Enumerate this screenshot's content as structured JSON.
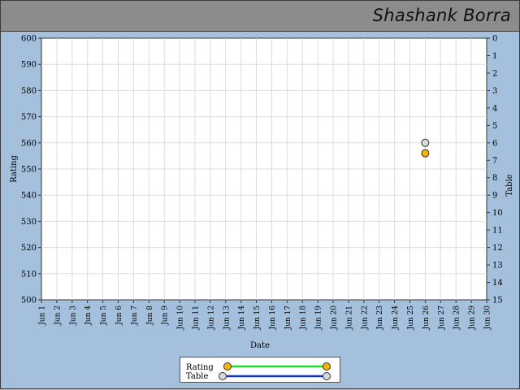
{
  "header": {
    "title": "Shashank Borra"
  },
  "colors": {
    "background": "#a5c0dc",
    "header_bg": "#8c8c8c",
    "plot_bg": "#ffffff",
    "grid": "#dddddd",
    "rating_marker": "#f5b400",
    "rating_line": "#22dd22",
    "table_marker": "#d8d8e0",
    "table_line": "#1133bb"
  },
  "chart_data": {
    "type": "scatter",
    "xlabel": "Date",
    "ylabel": "Rating",
    "y2label": "Table",
    "categories": [
      "Jun 1",
      "Jun 2",
      "Jun 3",
      "Jun 4",
      "Jun 5",
      "Jun 6",
      "Jun 7",
      "Jun 8",
      "Jun 9",
      "Jun 10",
      "Jun 11",
      "Jun 12",
      "Jun 13",
      "Jun 14",
      "Jun 15",
      "Jun 16",
      "Jun 17",
      "Jun 18",
      "Jun 19",
      "Jun 20",
      "Jun 21",
      "Jun 22",
      "Jun 23",
      "Jun 24",
      "Jun 25",
      "Jun 26",
      "Jun 27",
      "Jun 28",
      "Jun 29",
      "Jun 30"
    ],
    "ylim": [
      500,
      600
    ],
    "yticks": [
      "500",
      "510",
      "520",
      "530",
      "540",
      "550",
      "560",
      "570",
      "580",
      "590",
      "600"
    ],
    "y2lim": [
      0,
      15
    ],
    "y2ticks": [
      "0",
      "1",
      "2",
      "3",
      "4",
      "5",
      "6",
      "7",
      "8",
      "9",
      "10",
      "11",
      "12",
      "13",
      "14",
      "15"
    ],
    "grid": true,
    "legend_position": "bottom-center",
    "series": [
      {
        "name": "Rating",
        "axis": "left",
        "points": [
          {
            "x": "Jun 26",
            "y": 556
          }
        ]
      },
      {
        "name": "Table",
        "axis": "right",
        "points": [
          {
            "x": "Jun 26",
            "y": 6
          }
        ]
      }
    ]
  }
}
